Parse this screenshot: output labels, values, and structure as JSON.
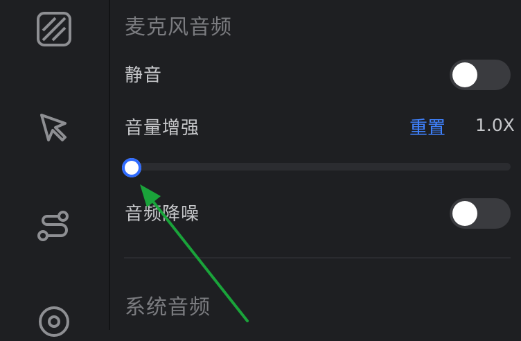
{
  "sidebar": {
    "icons": [
      "layers-icon",
      "cursor-icon",
      "path-icon",
      "audio-icon"
    ]
  },
  "mic_audio": {
    "title": "麦克风音频",
    "mute": {
      "label": "静音",
      "on": false
    },
    "boost": {
      "label": "音量增强",
      "reset_label": "重置",
      "value": "1.0X",
      "level": 0
    },
    "denoise": {
      "label": "音频降噪",
      "on": false
    }
  },
  "system_audio": {
    "title": "系统音频"
  },
  "colors": {
    "accent": "#2f6bff",
    "link": "#3f82ff",
    "background": "#1e1f22",
    "annotation": "#1aa33a"
  }
}
